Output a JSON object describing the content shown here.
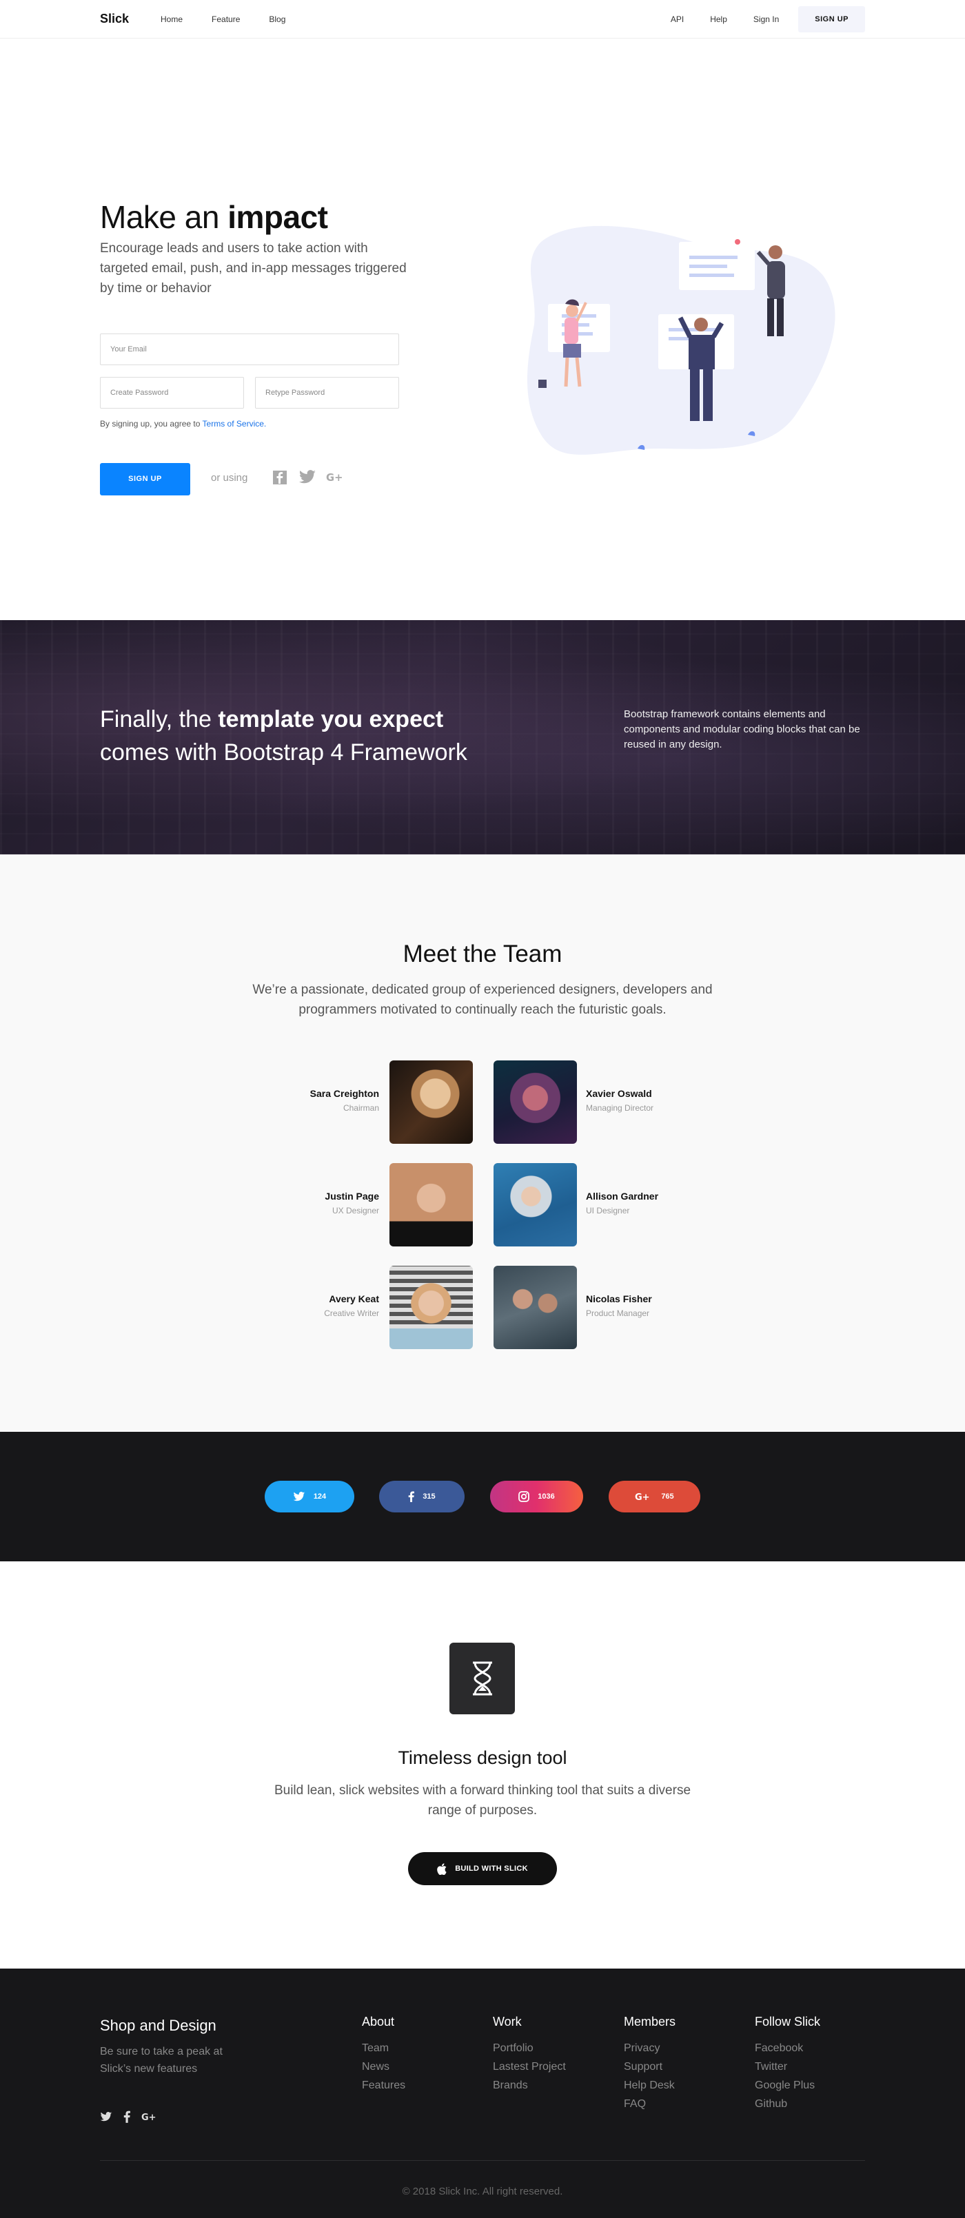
{
  "nav": {
    "brand": "Slick",
    "left_links": [
      "Home",
      "Feature",
      "Blog"
    ],
    "right_links": [
      "API",
      "Help",
      "Sign In"
    ],
    "signup": "SIGN UP"
  },
  "hero": {
    "title_pre": "Make an ",
    "title_bold": "impact",
    "lead": "Encourage leads and users to take action with targeted email, push, and in-app messages triggered by time or behavior",
    "email_placeholder": "Your Email",
    "password_placeholder": "Create Password",
    "retype_placeholder": "Retype Password",
    "terms_pre": "By signing up, you agree to ",
    "terms_link": "Terms of Service.",
    "signup_button": "SIGN UP",
    "or_using": "or using"
  },
  "city": {
    "title_pre": "Finally, the ",
    "title_bold": "template you expect",
    "title_post": "comes with Bootstrap 4 Framework",
    "text": "Bootstrap framework contains elements and components and modular coding blocks that can be reused in any design."
  },
  "team": {
    "title": "Meet the Team",
    "description": "We’re a passionate, dedicated group of experienced designers, developers and programmers motivated to continually reach the futuristic goals.",
    "members": [
      {
        "name": "Sara Creighton",
        "role": "Chairman"
      },
      {
        "name": "Xavier Oswald",
        "role": "Managing Director"
      },
      {
        "name": "Justin Page",
        "role": "UX Designer"
      },
      {
        "name": "Allison Gardner",
        "role": "UI Designer"
      },
      {
        "name": "Avery Keat",
        "role": "Creative Writer"
      },
      {
        "name": "Nicolas Fisher",
        "role": "Product Manager"
      }
    ]
  },
  "social_counts": [
    {
      "network": "twitter",
      "count": "124",
      "color": "#1da1f2"
    },
    {
      "network": "facebook",
      "count": "315",
      "color": "#3b5998"
    },
    {
      "network": "instagram",
      "count": "1036",
      "color": "#e1306c"
    },
    {
      "network": "google-plus",
      "count": "765",
      "color": "#dd4b39"
    }
  ],
  "timeless": {
    "icon": "hourglass-icon",
    "title": "Timeless design tool",
    "text": "Build lean, slick websites with a forward thinking tool that suits a diverse range of purposes.",
    "button": "BUILD WITH SLICK"
  },
  "footer": {
    "brand": "Shop and Design",
    "tagline": "Be sure to take a peak at Slick’s new features",
    "columns": [
      {
        "title": "About",
        "links": [
          "Team",
          "News",
          "Features"
        ]
      },
      {
        "title": "Work",
        "links": [
          "Portfolio",
          "Lastest Project",
          "Brands"
        ]
      },
      {
        "title": "Members",
        "links": [
          "Privacy",
          "Support",
          "Help Desk",
          "FAQ"
        ]
      },
      {
        "title": "Follow Slick",
        "links": [
          "Facebook",
          "Twitter",
          "Google Plus",
          "Github"
        ]
      }
    ],
    "copyright": "© 2018 Slick Inc. All right reserved."
  },
  "colors": {
    "accent": "#0a84ff",
    "dark": "#171719"
  }
}
